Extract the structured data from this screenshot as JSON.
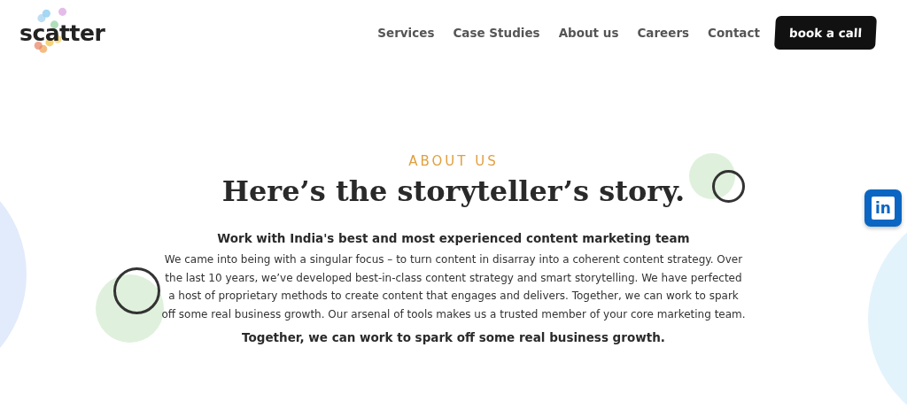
{
  "header": {
    "logo": "scatter",
    "nav": [
      "Services",
      "Case Studies",
      "About us",
      "Careers",
      "Contact"
    ],
    "cta": "book a call"
  },
  "about": {
    "eyebrow": "ABOUT US",
    "title": "Here’s the storyteller’s story.",
    "subtitle": "Work with India's best and most experienced content marketing team",
    "body": "We came into being with a singular focus – to turn content in disarray into a coherent content strategy. Over the last 10 years, we’ve developed best-in-class content strategy and smart storytelling. We have perfected a host of proprietary methods to create content that engages and delivers. Together, we can work to spark off some real business growth. Our arsenal of tools makes us a trusted member of your core marketing team.",
    "closing": "Together, we can work to spark off some real business growth."
  },
  "social": {
    "linkedin": "in"
  }
}
